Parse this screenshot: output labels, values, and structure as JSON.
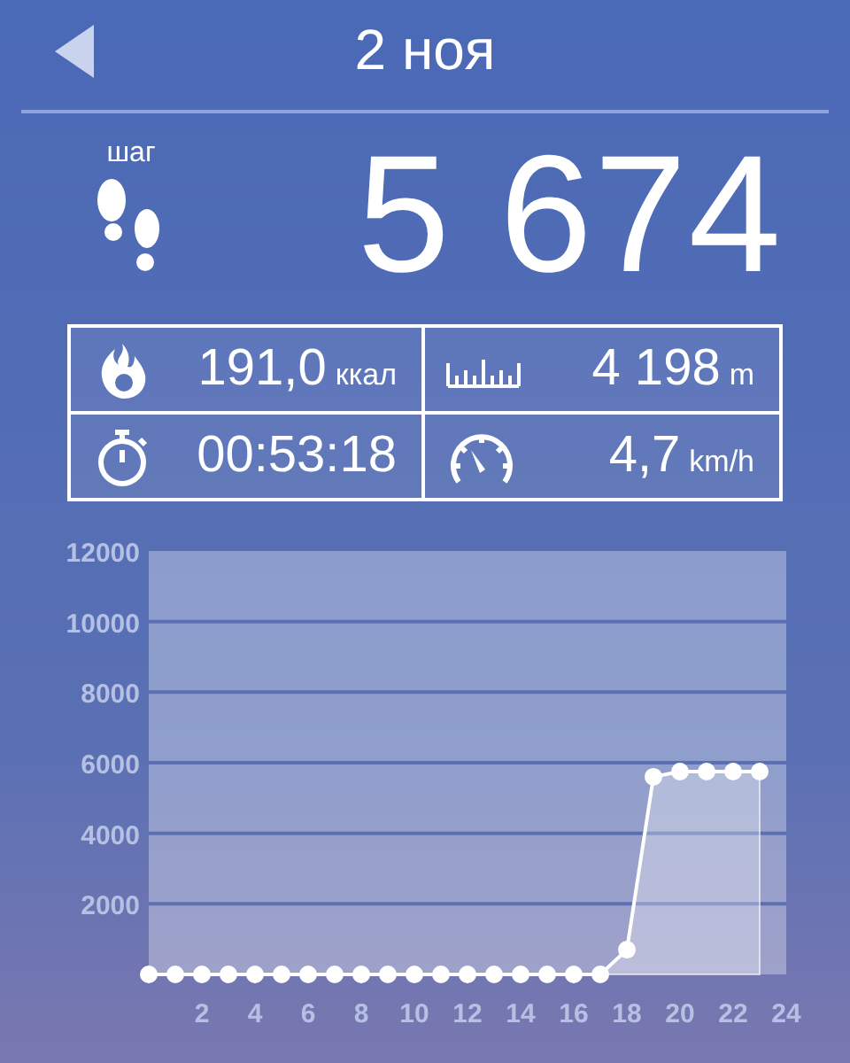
{
  "header": {
    "title": "2 ноя"
  },
  "steps": {
    "label": "шаг",
    "value": "5 674"
  },
  "stats": [
    {
      "kind": "calories",
      "value": "191,0",
      "unit": "ккал"
    },
    {
      "kind": "distance",
      "value": "4 198",
      "unit": "m"
    },
    {
      "kind": "duration",
      "value": "00:53:18"
    },
    {
      "kind": "speed",
      "value": "4,7",
      "unit": "km/h"
    }
  ],
  "chart_data": {
    "type": "area",
    "x": [
      0,
      1,
      2,
      3,
      4,
      5,
      6,
      7,
      8,
      9,
      10,
      11,
      12,
      13,
      14,
      15,
      16,
      17,
      18,
      19,
      20,
      21,
      22,
      23
    ],
    "values": [
      0,
      0,
      0,
      0,
      0,
      0,
      0,
      0,
      0,
      0,
      0,
      0,
      0,
      0,
      0,
      0,
      0,
      0,
      700,
      5600,
      5750,
      5750,
      5750,
      5750
    ],
    "grid": true,
    "xlim": [
      0,
      24
    ],
    "ylim": [
      0,
      12000
    ],
    "xticks": [
      2,
      4,
      6,
      8,
      10,
      12,
      14,
      16,
      18,
      20,
      22,
      24
    ],
    "yticks": [
      2000,
      4000,
      6000,
      8000,
      10000,
      12000
    ]
  }
}
